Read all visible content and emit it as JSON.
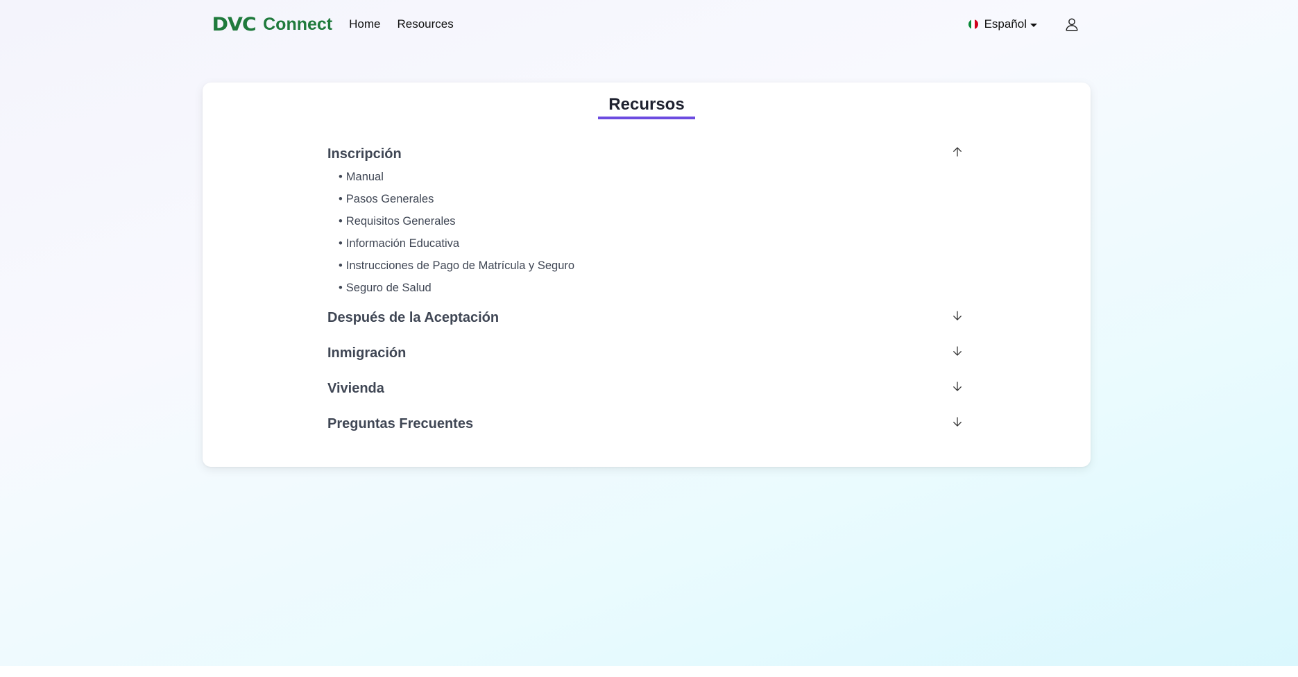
{
  "navbar": {
    "logo_text": "DVC",
    "brand_name": "Connect",
    "links": [
      "Home",
      "Resources"
    ],
    "language": "Español",
    "flag_colors": [
      "#0b8a3a",
      "#ffffff",
      "#d0021b"
    ]
  },
  "page": {
    "title": "Recursos",
    "accent_color": "#6c4be0"
  },
  "sections": [
    {
      "title": "Inscripción",
      "expanded": true,
      "icon": "arrow-up-icon",
      "items": [
        "Manual",
        "Pasos Generales",
        "Requisitos Generales",
        "Información Educativa",
        "Instrucciones de Pago de Matrícula y Seguro",
        "Seguro de Salud"
      ]
    },
    {
      "title": "Después de la Aceptación",
      "expanded": false,
      "icon": "arrow-down-icon"
    },
    {
      "title": "Inmigración",
      "expanded": false,
      "icon": "arrow-down-icon"
    },
    {
      "title": "Vivienda",
      "expanded": false,
      "icon": "arrow-down-icon"
    },
    {
      "title": "Preguntas Frecuentes",
      "expanded": false,
      "icon": "arrow-down-icon"
    }
  ],
  "bullet": "•"
}
